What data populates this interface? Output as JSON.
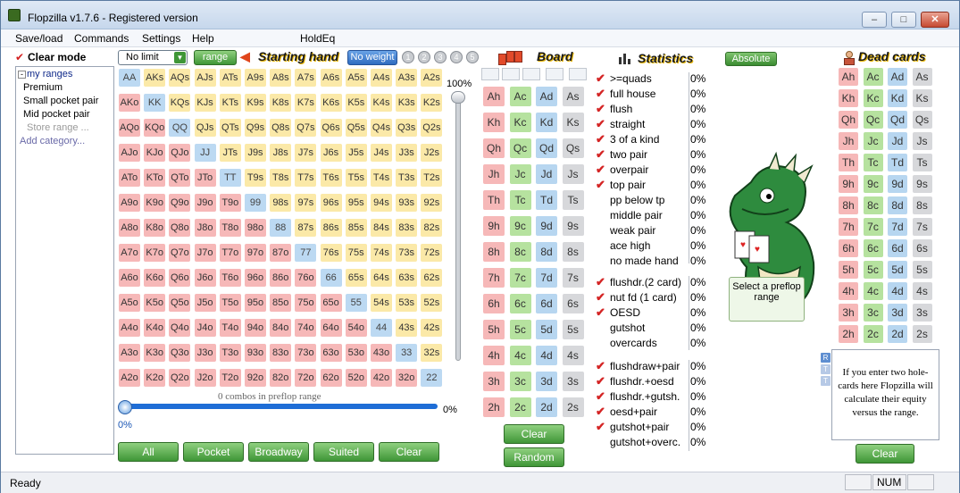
{
  "window": {
    "title": "Flopzilla v1.7.6 - Registered version"
  },
  "menu": [
    "Save/load",
    "Commands",
    "Settings",
    "Help",
    "HoldEq"
  ],
  "left": {
    "clear_mode": "Clear mode",
    "tree_root": "my ranges",
    "tree_items": [
      "Premium",
      "Small pocket pair",
      "Mid pocket pair",
      "Store range ...",
      "Add category..."
    ]
  },
  "hand": {
    "limit": "No limit",
    "range_btn": "range",
    "heading": "Starting hand",
    "weight_btn": "No weight",
    "weights": [
      "1",
      "2",
      "3",
      "4",
      "5"
    ],
    "vpct": "100%",
    "combos": "0 combos in preflop range",
    "hpct_right": "0%",
    "hpct_below": "0%",
    "grid": [
      [
        "AA",
        "AKs",
        "AQs",
        "AJs",
        "ATs",
        "A9s",
        "A8s",
        "A7s",
        "A6s",
        "A5s",
        "A4s",
        "A3s",
        "A2s"
      ],
      [
        "AKo",
        "KK",
        "KQs",
        "KJs",
        "KTs",
        "K9s",
        "K8s",
        "K7s",
        "K6s",
        "K5s",
        "K4s",
        "K3s",
        "K2s"
      ],
      [
        "AQo",
        "KQo",
        "QQ",
        "QJs",
        "QTs",
        "Q9s",
        "Q8s",
        "Q7s",
        "Q6s",
        "Q5s",
        "Q4s",
        "Q3s",
        "Q2s"
      ],
      [
        "AJo",
        "KJo",
        "QJo",
        "JJ",
        "JTs",
        "J9s",
        "J8s",
        "J7s",
        "J6s",
        "J5s",
        "J4s",
        "J3s",
        "J2s"
      ],
      [
        "ATo",
        "KTo",
        "QTo",
        "JTo",
        "TT",
        "T9s",
        "T8s",
        "T7s",
        "T6s",
        "T5s",
        "T4s",
        "T3s",
        "T2s"
      ],
      [
        "A9o",
        "K9o",
        "Q9o",
        "J9o",
        "T9o",
        "99",
        "98s",
        "97s",
        "96s",
        "95s",
        "94s",
        "93s",
        "92s"
      ],
      [
        "A8o",
        "K8o",
        "Q8o",
        "J8o",
        "T8o",
        "98o",
        "88",
        "87s",
        "86s",
        "85s",
        "84s",
        "83s",
        "82s"
      ],
      [
        "A7o",
        "K7o",
        "Q7o",
        "J7o",
        "T7o",
        "97o",
        "87o",
        "77",
        "76s",
        "75s",
        "74s",
        "73s",
        "72s"
      ],
      [
        "A6o",
        "K6o",
        "Q6o",
        "J6o",
        "T6o",
        "96o",
        "86o",
        "76o",
        "66",
        "65s",
        "64s",
        "63s",
        "62s"
      ],
      [
        "A5o",
        "K5o",
        "Q5o",
        "J5o",
        "T5o",
        "95o",
        "85o",
        "75o",
        "65o",
        "55",
        "54s",
        "53s",
        "52s"
      ],
      [
        "A4o",
        "K4o",
        "Q4o",
        "J4o",
        "T4o",
        "94o",
        "84o",
        "74o",
        "64o",
        "54o",
        "44",
        "43s",
        "42s"
      ],
      [
        "A3o",
        "K3o",
        "Q3o",
        "J3o",
        "T3o",
        "93o",
        "83o",
        "73o",
        "63o",
        "53o",
        "43o",
        "33",
        "32s"
      ],
      [
        "A2o",
        "K2o",
        "Q2o",
        "J2o",
        "T2o",
        "92o",
        "82o",
        "72o",
        "62o",
        "52o",
        "42o",
        "32o",
        "22"
      ]
    ],
    "buttons": [
      "All",
      "Pocket",
      "Broadway",
      "Suited",
      "Clear"
    ]
  },
  "board": {
    "heading": "Board",
    "cards": [
      [
        "Ah",
        "Ac",
        "Ad",
        "As"
      ],
      [
        "Kh",
        "Kc",
        "Kd",
        "Ks"
      ],
      [
        "Qh",
        "Qc",
        "Qd",
        "Qs"
      ],
      [
        "Jh",
        "Jc",
        "Jd",
        "Js"
      ],
      [
        "Th",
        "Tc",
        "Td",
        "Ts"
      ],
      [
        "9h",
        "9c",
        "9d",
        "9s"
      ],
      [
        "8h",
        "8c",
        "8d",
        "8s"
      ],
      [
        "7h",
        "7c",
        "7d",
        "7s"
      ],
      [
        "6h",
        "6c",
        "6d",
        "6s"
      ],
      [
        "5h",
        "5c",
        "5d",
        "5s"
      ],
      [
        "4h",
        "4c",
        "4d",
        "4s"
      ],
      [
        "3h",
        "3c",
        "3d",
        "3s"
      ],
      [
        "2h",
        "2c",
        "2d",
        "2s"
      ]
    ],
    "clear": "Clear",
    "random": "Random"
  },
  "stats": {
    "heading": "Statistics",
    "absolute": "Absolute",
    "group1": [
      {
        "label": ">=quads",
        "checked": true,
        "pct": "0%"
      },
      {
        "label": "full house",
        "checked": true,
        "pct": "0%"
      },
      {
        "label": "flush",
        "checked": true,
        "pct": "0%"
      },
      {
        "label": "straight",
        "checked": true,
        "pct": "0%"
      },
      {
        "label": "3 of a kind",
        "checked": true,
        "pct": "0%"
      },
      {
        "label": "two pair",
        "checked": true,
        "pct": "0%"
      },
      {
        "label": "overpair",
        "checked": true,
        "pct": "0%"
      },
      {
        "label": "top pair",
        "checked": true,
        "pct": "0%"
      },
      {
        "label": "pp below tp",
        "checked": false,
        "pct": "0%"
      },
      {
        "label": "middle pair",
        "checked": false,
        "pct": "0%"
      },
      {
        "label": "weak pair",
        "checked": false,
        "pct": "0%"
      },
      {
        "label": "ace high",
        "checked": false,
        "pct": "0%"
      },
      {
        "label": "no made hand",
        "checked": false,
        "pct": "0%"
      }
    ],
    "group2": [
      {
        "label": "flushdr.(2 card)",
        "checked": true,
        "pct": "0%"
      },
      {
        "label": "nut fd (1 card)",
        "checked": true,
        "pct": "0%"
      },
      {
        "label": "OESD",
        "checked": true,
        "pct": "0%"
      },
      {
        "label": "gutshot",
        "checked": false,
        "pct": "0%"
      },
      {
        "label": "overcards",
        "checked": false,
        "pct": "0%"
      }
    ],
    "group3": [
      {
        "label": "flushdraw+pair",
        "checked": true,
        "pct": "0%"
      },
      {
        "label": "flushdr.+oesd",
        "checked": true,
        "pct": "0%"
      },
      {
        "label": "flushdr.+gutsh.",
        "checked": true,
        "pct": "0%"
      },
      {
        "label": "oesd+pair",
        "checked": true,
        "pct": "0%"
      },
      {
        "label": "gutshot+pair",
        "checked": true,
        "pct": "0%"
      },
      {
        "label": "gutshot+overc.",
        "checked": false,
        "pct": "0%"
      }
    ],
    "select_msg": "Select a preflop range"
  },
  "dead": {
    "heading": "Dead cards",
    "help": "If you enter two hole-cards here Flopzilla will calculate their equity versus the range.",
    "rtt": [
      "R",
      "T",
      "T"
    ],
    "clear": "Clear"
  },
  "status": {
    "text": "Ready",
    "num": "NUM"
  },
  "colors": {
    "hearts": "#f6b8b8",
    "clubs": "#b6e29f",
    "diamonds": "#b7d6f0",
    "spades": "#d7d8db",
    "pairs": "#bcd9f2",
    "suited": "#fbe9a8",
    "offsuit": "#f6b8b8",
    "accent": "#3f9637"
  }
}
